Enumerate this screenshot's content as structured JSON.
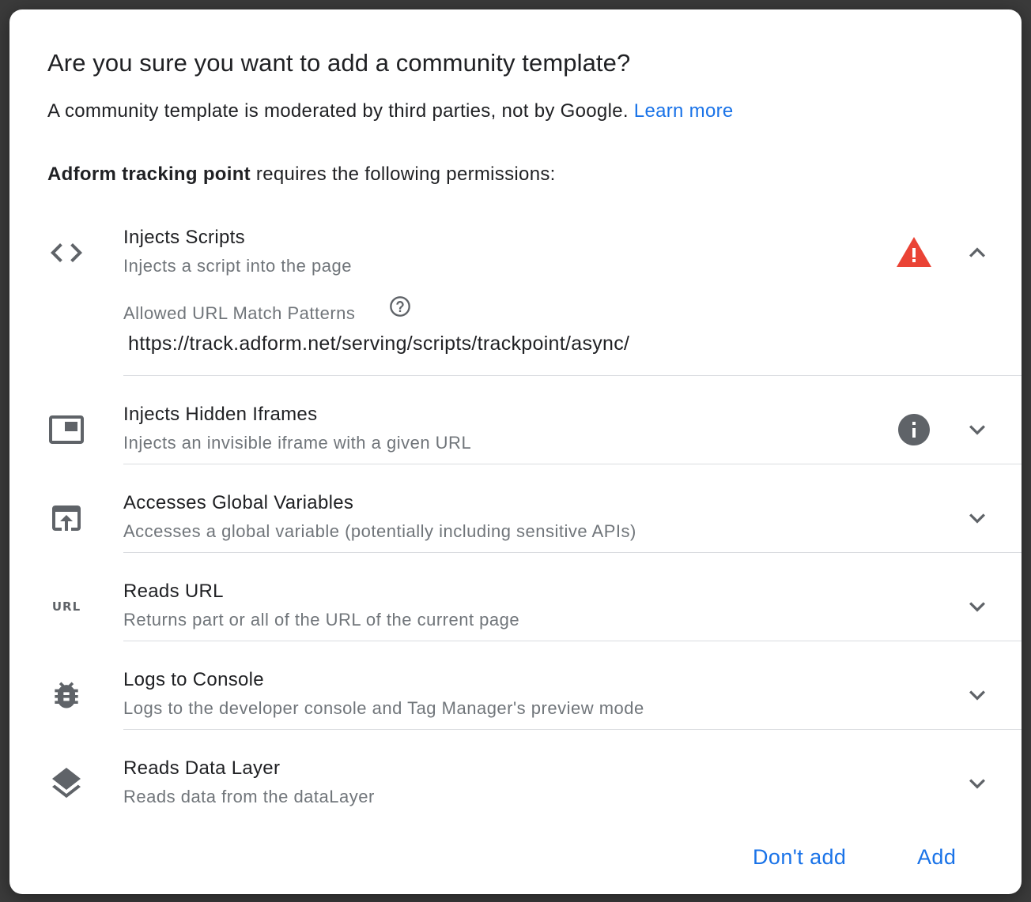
{
  "dialog": {
    "title": "Are you sure you want to add a community template?",
    "subtitle": "A community template is moderated by third parties, not by Google.",
    "learn_more": "Learn more",
    "template_name": "Adform tracking point",
    "requires_text": " requires the following permissions:"
  },
  "permissions": [
    {
      "icon": "code-icon",
      "title": "Injects Scripts",
      "description": "Injects a script into the page",
      "status": "warning",
      "expanded": true,
      "detail_label": "Allowed URL Match Patterns",
      "detail_value": "https://track.adform.net/serving/scripts/trackpoint/async/"
    },
    {
      "icon": "iframe-icon",
      "title": "Injects Hidden Iframes",
      "description": "Injects an invisible iframe with a given URL",
      "status": "info",
      "expanded": false
    },
    {
      "icon": "open-in-browser-icon",
      "title": "Accesses Global Variables",
      "description": "Accesses a global variable (potentially including sensitive APIs)",
      "expanded": false
    },
    {
      "icon": "url-icon",
      "icon_text": "URL",
      "title": "Reads URL",
      "description": "Returns part or all of the URL of the current page",
      "expanded": false
    },
    {
      "icon": "bug-icon",
      "title": "Logs to Console",
      "description": "Logs to the developer console and Tag Manager's preview mode",
      "expanded": false
    },
    {
      "icon": "layers-icon",
      "title": "Reads Data Layer",
      "description": "Reads data from the dataLayer",
      "expanded": false
    }
  ],
  "actions": {
    "cancel_label": "Don't add",
    "confirm_label": "Add"
  },
  "colors": {
    "accent": "#1a73e8",
    "warning": "#ea4335",
    "icon_gray": "#5f6368",
    "text_primary": "#202124",
    "text_secondary": "#70757a"
  }
}
